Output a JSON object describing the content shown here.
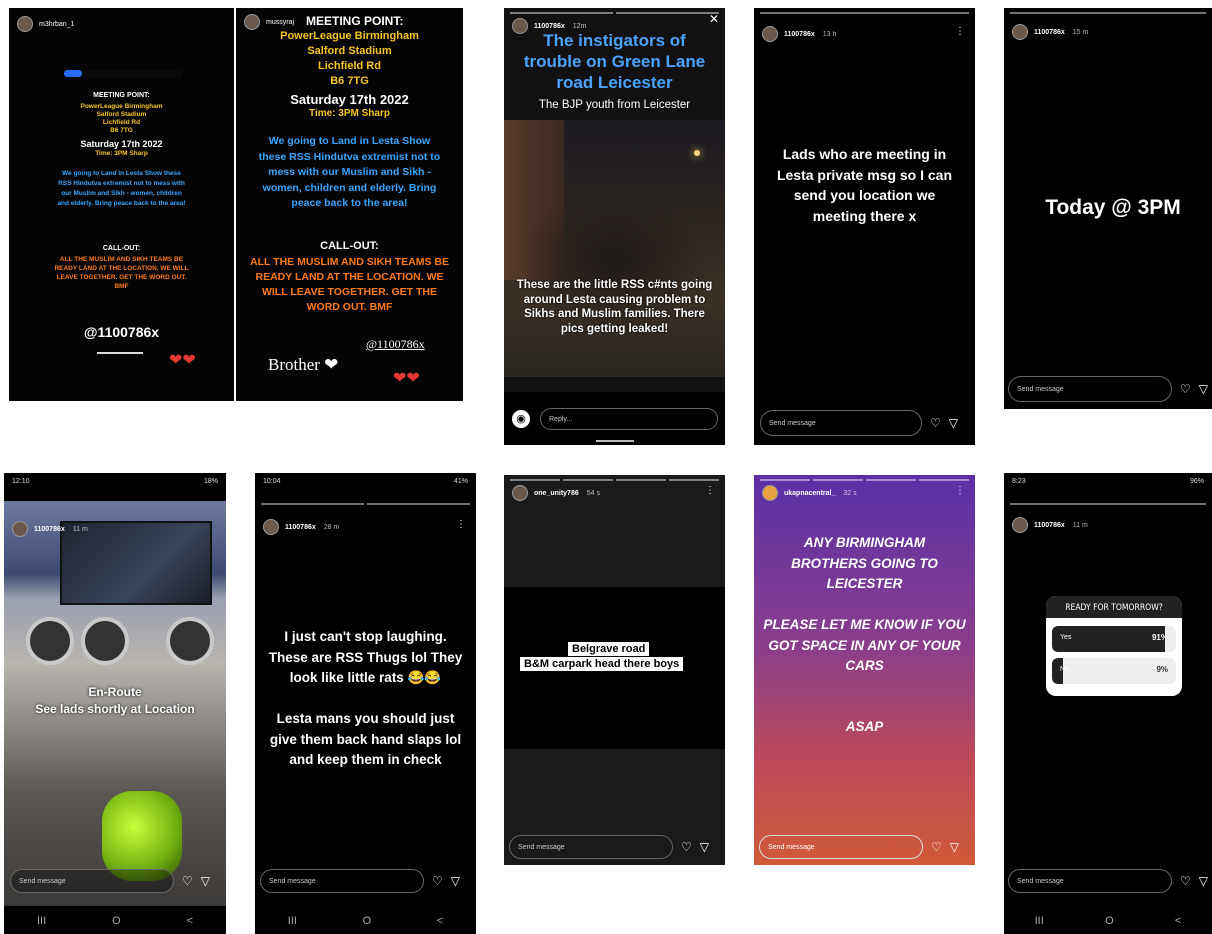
{
  "p1": {
    "username": "m3hrban_1",
    "title": "MEETING POINT:",
    "loc1": "PowerLeague Birmingham",
    "loc2": "Salford Stadium",
    "loc3": "Lichfield Rd",
    "loc4": "B6 7TG",
    "date": "Saturday 17th 2022",
    "time": "Time: 3PM Sharp",
    "body": "We going to Land in Lesta Show these RSS Hindutva extremist not to mess with our Muslim and Sikh - women, children and elderly. Bring peace back to the area!",
    "callout_title": "CALL-OUT:",
    "callout_body": "ALL THE MUSLIM AND SIKH TEAMS BE READY LAND AT THE LOCATION. WE WILL LEAVE TOGETHER. GET THE WORD OUT. BMF",
    "handle": "@1100786x",
    "hearts": "❤❤"
  },
  "p2": {
    "username": "mussyraj",
    "title": "MEETING POINT:",
    "loc1": "PowerLeague Birmingham",
    "loc2": "Salford Stadium",
    "loc3": "Lichfield Rd",
    "loc4": "B6 7TG",
    "date": "Saturday 17th 2022",
    "time": "Time: 3PM Sharp",
    "body": "We going to Land in Lesta Show these RSS Hindutva extremist not to mess with our Muslim and Sikh - women, children and elderly. Bring peace back to the area!",
    "callout_title": "CALL-OUT:",
    "callout_body": "ALL THE MUSLIM AND SIKH TEAMS BE READY LAND AT THE LOCATION. WE WILL LEAVE TOGETHER. GET THE WORD OUT. BMF",
    "handle": "@1100786x",
    "brother": "Brother ❤",
    "hearts": "❤❤"
  },
  "p3": {
    "username": "1100786x",
    "time": "12m",
    "headline": "The instigators of trouble on Green Lane road Leicester",
    "subhead": "The BJP youth from Leicester",
    "caption": "These are the little RSS c#nts going around Lesta causing problem to Sikhs and Muslim families. There pics getting leaked!",
    "reply_placeholder": "Reply..."
  },
  "p4": {
    "username": "1100786x",
    "time": "13 h",
    "message": "Lads who are meeting in Lesta private msg so I can send you location we meeting there x",
    "send_placeholder": "Send message"
  },
  "p5": {
    "username": "1100786x",
    "time": "15 m",
    "message": "Today @ 3PM",
    "send_placeholder": "Send message"
  },
  "p6": {
    "status_time": "12:10",
    "status_right": "18%",
    "username": "1100786x",
    "time": "11 m",
    "line1": "En-Route",
    "line2": "See lads shortly at Location",
    "send_placeholder": "Send message"
  },
  "p7": {
    "status_time": "10:04",
    "status_right": "41%",
    "username": "1100786x",
    "time": "28 m",
    "message1": "I just can't stop laughing. These are RSS Thugs lol They look like little rats 😂😂",
    "message2": "Lesta mans you should just give them back hand slaps lol and keep them in check",
    "send_placeholder": "Send message"
  },
  "p8": {
    "username": "one_unity786",
    "time": "54 s",
    "line1": "Belgrave road",
    "line2": "B&M carpark head there boys",
    "send_placeholder": "Send message"
  },
  "p9": {
    "username": "ukapnacentral_",
    "time": "32 s",
    "line1": "ANY BIRMINGHAM BROTHERS GOING TO LEICESTER",
    "line2": "PLEASE LET ME KNOW IF YOU GOT SPACE IN ANY OF YOUR CARS",
    "line3": "ASAP",
    "send_placeholder": "Send message"
  },
  "p10": {
    "status_time": "8:23",
    "status_right": "96%",
    "username": "1100786x",
    "time": "11 m",
    "poll_question": "READY FOR TOMORROW?",
    "opt1": "Yes",
    "opt1_pct": "91%",
    "opt1_value": 91,
    "opt2": "No",
    "opt2_pct": "9%",
    "opt2_value": 9,
    "send_placeholder": "Send message"
  },
  "icons": {
    "heart": "♡",
    "send": "▽",
    "camera": "◉",
    "close": "✕",
    "menu": "⋮",
    "nav_recent": "III",
    "nav_home": "O",
    "nav_back": "<"
  }
}
